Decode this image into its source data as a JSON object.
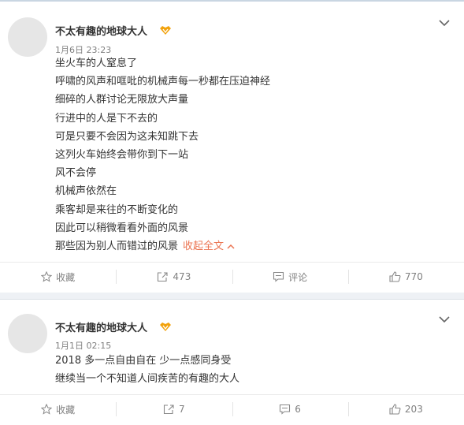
{
  "posts": [
    {
      "username": "不太有趣的地球大人",
      "time": "1月6日 23:23",
      "lines": [
        "坐火车的人窒息了",
        "呼啸的风声和哐吡的机械声每一秒都在压迫神经",
        "细碎的人群讨论无限放大声量",
        "行进中的人是下不去的",
        "可是只要不会因为这未知跳下去",
        "这列火车始终会带你到下一站",
        "风不会停",
        "机械声依然在",
        "乘客却是来往的不断变化的",
        "因此可以稍微看看外面的风景",
        "那些因为别人而错过的风景"
      ],
      "collapse_label": "收起全文",
      "actions": {
        "favorite": "收藏",
        "repost": "473",
        "comment": "评论",
        "like": "770"
      }
    },
    {
      "username": "不太有趣的地球大人",
      "time": "1月1日 02:15",
      "lines": [
        "2018 多一点自由自在 少一点感同身受",
        "继续当一个不知道人间疾苦的有趣的大人"
      ],
      "actions": {
        "favorite": "收藏",
        "repost": "7",
        "comment": "6",
        "like": "203"
      }
    }
  ],
  "colors": {
    "accent": "#eb7350",
    "text": "#333333",
    "meta": "#808080",
    "vip_badge": "#f2a20c"
  },
  "icons": {
    "vip": "vip-badge-icon",
    "more": "chevron-down-icon",
    "favorite": "star-icon",
    "repost": "repost-icon",
    "comment": "comment-icon",
    "like": "thumbs-up-icon"
  }
}
